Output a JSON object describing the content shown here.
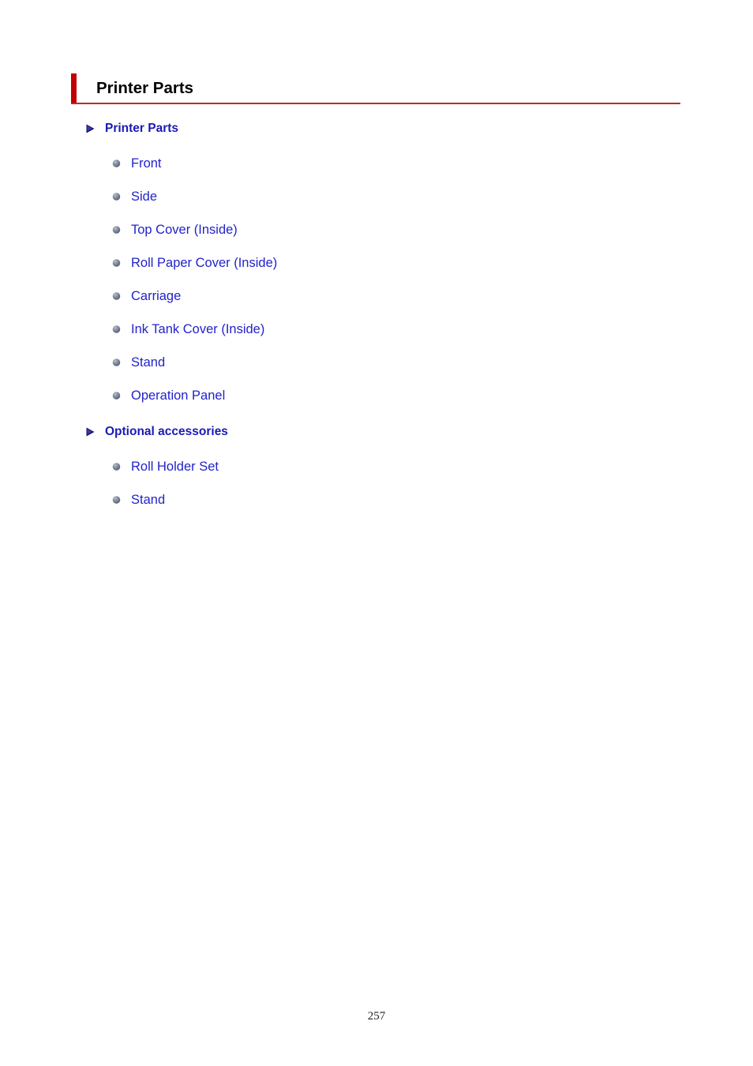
{
  "document": {
    "title": "Printer Parts",
    "page_number": "257",
    "accent_bar_color": "#C00000",
    "rule_color": "#C0282C",
    "heading_link_color": "#1A1AB4",
    "item_link_color": "#2222CC"
  },
  "outline": {
    "groups": [
      {
        "heading": "Printer Parts",
        "bullet_icon": "arrow-right-icon",
        "items": [
          {
            "label": "Front",
            "bullet_icon": "sphere-bullet-icon"
          },
          {
            "label": "Side",
            "bullet_icon": "sphere-bullet-icon"
          },
          {
            "label": "Top Cover (Inside)",
            "bullet_icon": "sphere-bullet-icon"
          },
          {
            "label": "Roll Paper Cover (Inside)",
            "bullet_icon": "sphere-bullet-icon"
          },
          {
            "label": "Carriage",
            "bullet_icon": "sphere-bullet-icon"
          },
          {
            "label": "Ink Tank Cover (Inside)",
            "bullet_icon": "sphere-bullet-icon"
          },
          {
            "label": "Stand",
            "bullet_icon": "sphere-bullet-icon"
          },
          {
            "label": "Operation Panel",
            "bullet_icon": "sphere-bullet-icon"
          }
        ]
      },
      {
        "heading": "Optional accessories",
        "bullet_icon": "arrow-right-icon",
        "items": [
          {
            "label": "Roll Holder Set",
            "bullet_icon": "sphere-bullet-icon"
          },
          {
            "label": "Stand",
            "bullet_icon": "sphere-bullet-icon"
          }
        ]
      }
    ]
  }
}
